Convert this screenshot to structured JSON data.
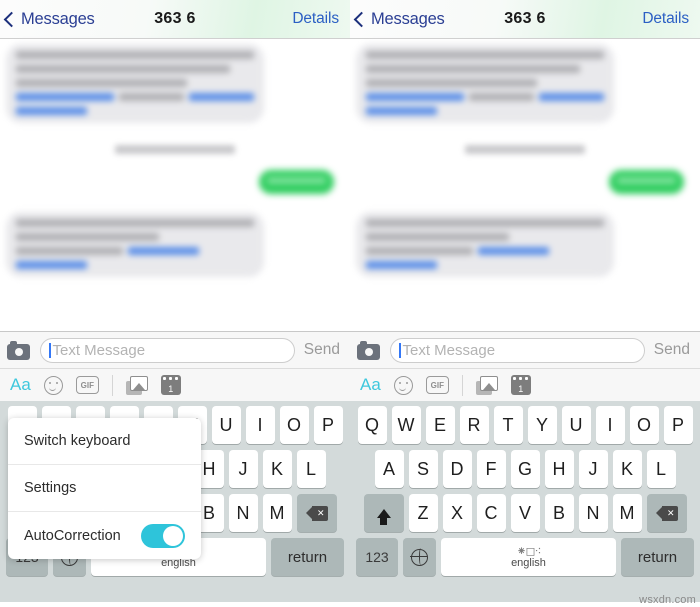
{
  "navbar": {
    "back_label": "Messages",
    "title": "363 6",
    "details_label": "Details"
  },
  "input_bar": {
    "placeholder": "Text Message",
    "value": "",
    "send_label": "Send",
    "camera_icon": "camera-icon"
  },
  "app_tray": {
    "items": [
      {
        "label": "Aa",
        "icon": "text-format-icon"
      },
      {
        "label": "",
        "icon": "smiley-icon"
      },
      {
        "label": "GIF",
        "icon": "gif-icon"
      },
      {
        "label": "",
        "icon": "photos-icon"
      },
      {
        "label": "1",
        "icon": "calendar-icon"
      }
    ]
  },
  "popup_menu": {
    "items": [
      {
        "label": "Switch keyboard",
        "control": "none"
      },
      {
        "label": "Settings",
        "control": "none"
      },
      {
        "label": "AutoCorrection",
        "control": "toggle",
        "toggle_on": true
      }
    ]
  },
  "keyboard": {
    "row1": [
      "Q",
      "W",
      "E",
      "R",
      "T",
      "Y",
      "U",
      "I",
      "O",
      "P"
    ],
    "row2": [
      "A",
      "S",
      "D",
      "F",
      "G",
      "H",
      "J",
      "K",
      "L"
    ],
    "row3": [
      "Z",
      "X",
      "C",
      "V",
      "B",
      "N",
      "M"
    ],
    "shift_icon": "shift-icon",
    "backspace_icon": "backspace-icon",
    "numbers_label": "123",
    "globe_icon": "globe-icon",
    "space_label": "english",
    "return_label": "return"
  },
  "watermark": {
    "text": "wsxdn.com"
  },
  "colors": {
    "accent_blue": "#2b5fc4",
    "outgoing_bubble_green": "#2ecd5e",
    "incoming_bubble_gray": "#e9e9ec",
    "toggle_teal": "#2ec4da",
    "aa_teal": "#3ec8dd",
    "keyboard_bg": "#d3dada"
  }
}
